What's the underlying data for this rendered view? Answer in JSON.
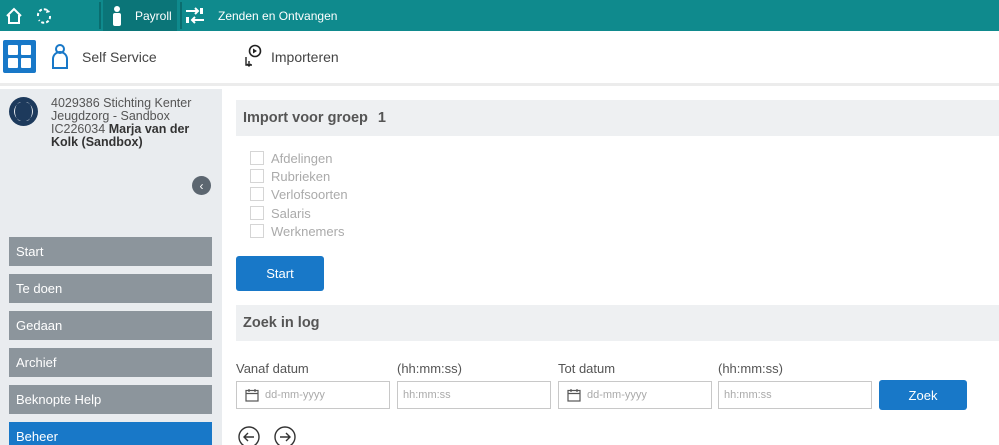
{
  "topbar": {
    "payroll_label": "Payroll",
    "send_receive_label": "Zenden en Ontvangen",
    "icons": [
      "home-icon",
      "refresh-icon",
      "person-icon",
      "transfer-icon"
    ]
  },
  "appbar": {
    "self_service_label": "Self Service",
    "import_label": "Importeren"
  },
  "sidebar": {
    "org_line1": "4029386 Stichting Kenter Jeugdzorg - Sandbox",
    "org_code": "IC226034",
    "user_name": "Marja van der Kolk (Sandbox)",
    "items": [
      {
        "label": "Start"
      },
      {
        "label": "Te doen"
      },
      {
        "label": "Gedaan"
      },
      {
        "label": "Archief"
      },
      {
        "label": "Beknopte Help"
      },
      {
        "label": "Beheer"
      }
    ]
  },
  "import": {
    "title": "Import voor groep",
    "group_number": "1",
    "options": [
      "Afdelingen",
      "Rubrieken",
      "Verlofsoorten",
      "Salaris",
      "Werknemers"
    ],
    "start_label": "Start"
  },
  "log": {
    "title": "Zoek in log",
    "from_date_label": "Vanaf datum",
    "from_time_label": "(hh:mm:ss)",
    "to_date_label": "Tot datum",
    "to_time_label": "(hh:mm:ss)",
    "date_placeholder": "dd-mm-yyyy",
    "time_placeholder": "hh:mm:ss",
    "search_label": "Zoek"
  },
  "colors": {
    "topbar": "#0f8a8d",
    "accent": "#1878c8",
    "nav_item": "#8c959c"
  }
}
